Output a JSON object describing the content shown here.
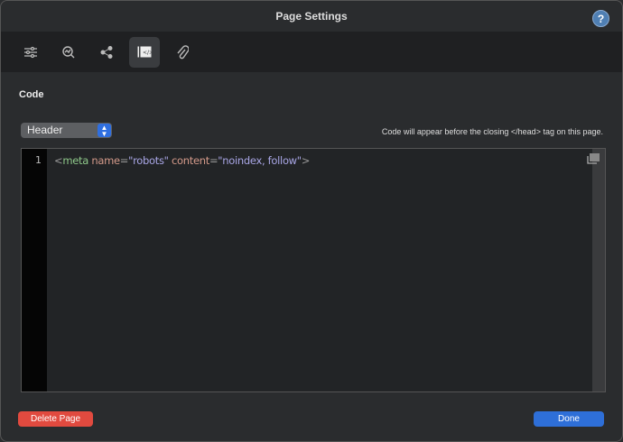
{
  "window": {
    "title": "Page Settings",
    "help_label": "?"
  },
  "toolbar": {
    "tabs": [
      {
        "icon": "sliders-icon"
      },
      {
        "icon": "seo-search-icon"
      },
      {
        "icon": "share-icon"
      },
      {
        "icon": "code-icon",
        "active": true
      },
      {
        "icon": "paperclip-icon"
      }
    ]
  },
  "section": {
    "title": "Code"
  },
  "select": {
    "value": "Header"
  },
  "hint": "Code will appear before the closing </head> tag on this page.",
  "editor": {
    "line_number": "1",
    "code": {
      "open": "<",
      "tag": "meta",
      "attr1": "name",
      "eq": "=",
      "val1": "\"robots\"",
      "attr2": "content",
      "val2": "\"noindex, follow\"",
      "close": ">"
    }
  },
  "buttons": {
    "delete": "Delete Page",
    "done": "Done"
  }
}
